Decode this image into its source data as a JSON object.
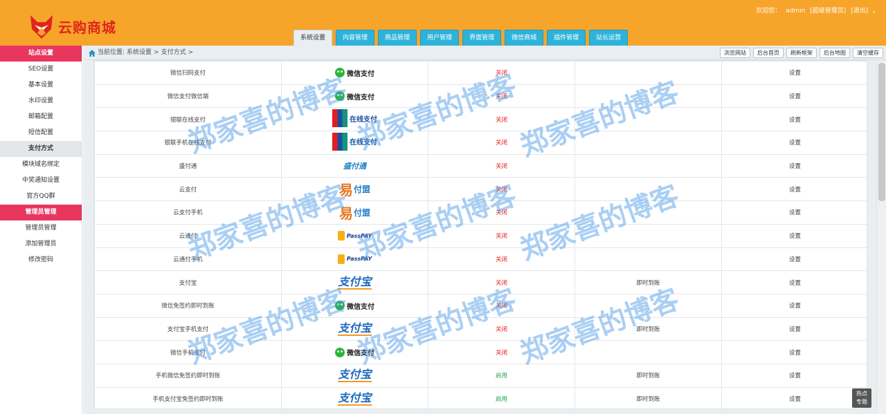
{
  "brand": {
    "name": "云购商城",
    "logo_color": "#e0251b",
    "header_color": "#f7a42b"
  },
  "userbar": {
    "welcome": "欢迎您：",
    "username": "admin",
    "role": "[超级管理员]",
    "logout": "[退出]",
    "suffix": "。"
  },
  "tabs": [
    {
      "label": "系统设置",
      "active": true
    },
    {
      "label": "内容管理",
      "active": false
    },
    {
      "label": "商品管理",
      "active": false
    },
    {
      "label": "用户管理",
      "active": false
    },
    {
      "label": "界面管理",
      "active": false
    },
    {
      "label": "微信商城",
      "active": false
    },
    {
      "label": "插件管理",
      "active": false
    },
    {
      "label": "站长运营",
      "active": false
    }
  ],
  "sidebar": {
    "section1": "站点设置",
    "items1": [
      "SEO设置",
      "基本设置",
      "水印设置",
      "邮箱配置",
      "短信配置",
      "支付方式",
      "模块域名绑定",
      "中奖通知设置",
      "官方QQ群"
    ],
    "active_item": "支付方式",
    "section2": "管理员管理",
    "items2": [
      "管理员管理",
      "添加管理员",
      "修改密码"
    ]
  },
  "breadcrumb": {
    "prefix": "当前位置:",
    "path1": "系统设置",
    "sep": ">",
    "path2": "支付方式",
    "sep2": ">"
  },
  "toolbar": [
    "浏览网站",
    "后台首页",
    "刷新框架",
    "后台地图",
    "清空缓存"
  ],
  "payments": [
    {
      "name": "微信扫码支付",
      "logo": "wechat",
      "logo_text": "微信支付",
      "status": "关闭",
      "enabled": false,
      "arrival": "",
      "action": "设置"
    },
    {
      "name": "微信支付微信端",
      "logo": "wechat",
      "logo_text": "微信支付",
      "status": "关闭",
      "enabled": false,
      "arrival": "",
      "action": "设置"
    },
    {
      "name": "银联在线支付",
      "logo": "unionpay",
      "logo_text": "在线支付",
      "status": "关闭",
      "enabled": false,
      "arrival": "",
      "action": "设置"
    },
    {
      "name": "银联手机在线支付",
      "logo": "unionpay",
      "logo_text": "在线支付",
      "status": "关闭",
      "enabled": false,
      "arrival": "",
      "action": "设置"
    },
    {
      "name": "盛付通",
      "logo": "shengpay",
      "logo_text": "盛付通",
      "status": "关闭",
      "enabled": false,
      "arrival": "",
      "action": "设置"
    },
    {
      "name": "云支付",
      "logo": "yipay",
      "logo_text": "付盟",
      "status": "关闭",
      "enabled": false,
      "arrival": "",
      "action": "设置"
    },
    {
      "name": "云支付手机",
      "logo": "yipay",
      "logo_text": "付盟",
      "status": "关闭",
      "enabled": false,
      "arrival": "",
      "action": "设置"
    },
    {
      "name": "云通付",
      "logo": "passpay",
      "logo_text": "PassPAY",
      "status": "关闭",
      "enabled": false,
      "arrival": "",
      "action": "设置"
    },
    {
      "name": "云通付手机",
      "logo": "passpay",
      "logo_text": "PassPAY",
      "status": "关闭",
      "enabled": false,
      "arrival": "",
      "action": "设置"
    },
    {
      "name": "支付宝",
      "logo": "alipay",
      "logo_text": "支付宝",
      "status": "关闭",
      "enabled": false,
      "arrival": "即时到账",
      "action": "设置"
    },
    {
      "name": "微信免签约即时到账",
      "logo": "wechat",
      "logo_text": "微信支付",
      "status": "关闭",
      "enabled": false,
      "arrival": "",
      "action": "设置"
    },
    {
      "name": "支付宝手机支付",
      "logo": "alipay",
      "logo_text": "支付宝",
      "status": "关闭",
      "enabled": false,
      "arrival": "即时到账",
      "action": "设置"
    },
    {
      "name": "微信手机支付",
      "logo": "wechat",
      "logo_text": "微信支付",
      "status": "关闭",
      "enabled": false,
      "arrival": "",
      "action": "设置"
    },
    {
      "name": "手机微信免签约即时到账",
      "logo": "alipay",
      "logo_text": "支付宝",
      "status": "启用",
      "enabled": true,
      "arrival": "即时到账",
      "action": "设置"
    },
    {
      "name": "手机支付宝免签约即时到账",
      "logo": "alipay",
      "logo_text": "支付宝",
      "status": "启用",
      "enabled": true,
      "arrival": "即时到账",
      "action": "设置"
    }
  ],
  "watermark": "郑家喜的博客",
  "hot_badge": {
    "line1": "热点",
    "line2": "专题"
  }
}
